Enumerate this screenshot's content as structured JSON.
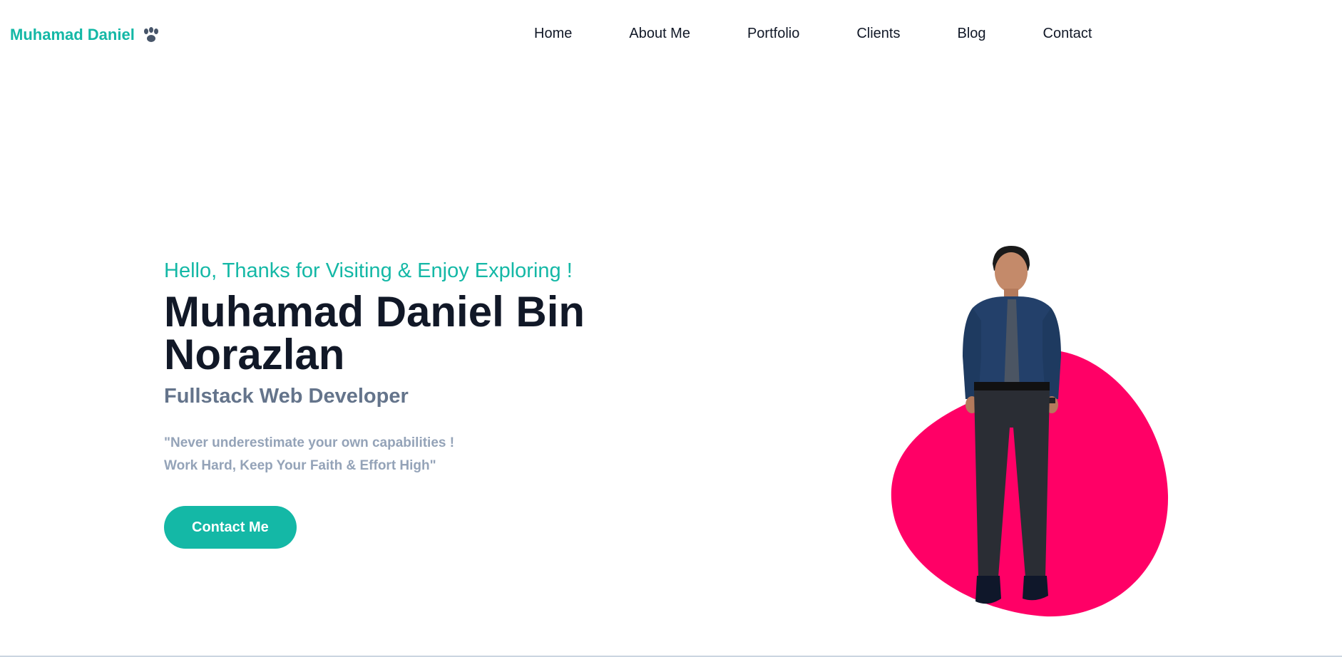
{
  "brand": {
    "name": "Muhamad Daniel",
    "icon": "paw-icon",
    "color": "#14b8a6"
  },
  "nav": {
    "items": [
      {
        "label": "Home"
      },
      {
        "label": "About Me"
      },
      {
        "label": "Portfolio"
      },
      {
        "label": "Clients"
      },
      {
        "label": "Blog"
      },
      {
        "label": "Contact"
      }
    ]
  },
  "hero": {
    "greeting": "Hello, Thanks for Visiting & Enjoy Exploring !",
    "name_line1": "Muhamad Daniel Bin",
    "name_line2": "Norazlan",
    "role": "Fullstack Web Developer",
    "quote_line1": "\"Never underestimate your own capabilities !",
    "quote_line2": "Work Hard, Keep Your Faith & Effort High\"",
    "cta_label": "Contact Me"
  },
  "colors": {
    "accent": "#14b8a6",
    "blob": "#ff0066",
    "heading": "#111827",
    "subtitle": "#64748b",
    "quote": "#94a3b8"
  },
  "portrait": {
    "subject": "profile-photo"
  }
}
